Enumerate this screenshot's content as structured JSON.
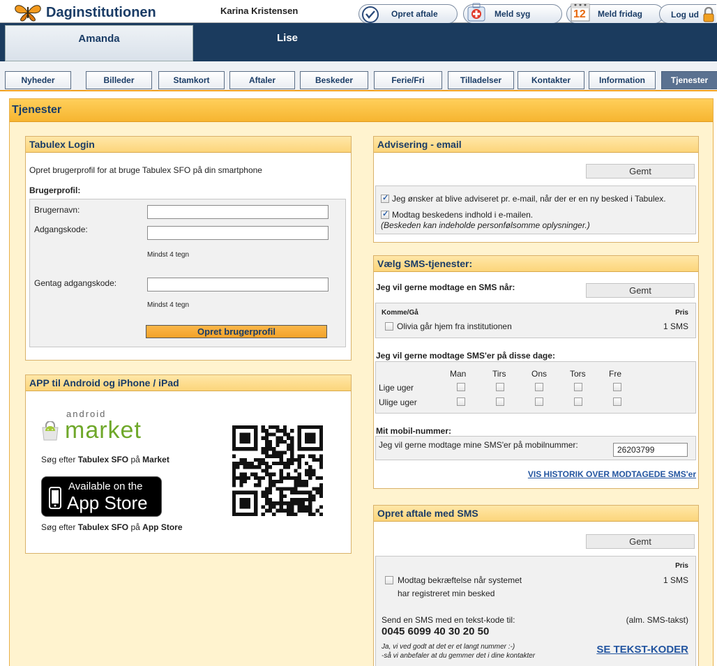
{
  "header": {
    "app_name": "Daginstitutionen",
    "user_name": "Karina Kristensen",
    "buttons": {
      "appointment": "Opret aftale",
      "sick": "Meld syg",
      "dayoff": "Meld fridag",
      "calendar_day": "12",
      "logout": "Log ud"
    }
  },
  "children": [
    {
      "name": "Amanda"
    },
    {
      "name": "Lise"
    }
  ],
  "nav": [
    {
      "label": "Nyheder"
    },
    {
      "label": "Billeder"
    },
    {
      "label": "Stamkort"
    },
    {
      "label": "Aftaler"
    },
    {
      "label": "Beskeder"
    },
    {
      "label": "Ferie/Fri"
    },
    {
      "label": "Tilladelser"
    },
    {
      "label": "Kontakter"
    },
    {
      "label": "Information"
    },
    {
      "label": "Tjenester"
    }
  ],
  "page": {
    "title": "Tjenester"
  },
  "login": {
    "title": "Tabulex Login",
    "intro": "Opret brugerprofil for at bruge Tabulex SFO på din smartphone",
    "profile_heading": "Brugerprofil:",
    "username_label": "Brugernavn:",
    "password_label": "Adgangskode:",
    "min_hint": "Mindst 4 tegn",
    "repeat_label": "Gentag adgangskode:",
    "submit": "Opret brugerprofil"
  },
  "app": {
    "title": "APP til Android og iPhone / iPad",
    "android_small": "android",
    "android_big": "market",
    "android_pre": "Søg efter ",
    "android_mid": "Tabulex SFO",
    "android_on": " på ",
    "android_post": "Market",
    "appstore_line1": "Available on the",
    "appstore_line2": "App Store",
    "ios_pre": "Søg efter ",
    "ios_mid": "Tabulex SFO",
    "ios_on": " på ",
    "ios_post": "App Store"
  },
  "email": {
    "title": "Advisering - email",
    "saved": "Gemt",
    "opt1": "Jeg ønsker at blive adviseret pr. e-mail, når der er en ny besked i Tabulex.",
    "opt2": "Modtag beskedens indhold i e-mailen.",
    "note": "(Beskeden kan indeholde personfølsomme oplysninger.)"
  },
  "sms": {
    "title": "Vælg SMS-tjenester:",
    "intro": "Jeg vil gerne modtage en SMS når:",
    "saved": "Gemt",
    "group": "Komme/Gå",
    "price_header": "Pris",
    "item": "Olivia går hjem fra institutionen",
    "item_price": "1 SMS",
    "days_heading": "Jeg vil gerne modtage SMS'er på disse dage:",
    "days": [
      "Man",
      "Tirs",
      "Ons",
      "Tors",
      "Fre"
    ],
    "rows": [
      "Lige uger",
      "Ulige uger"
    ],
    "mobile_heading": "Mit mobil-nummer:",
    "mobile_label": "Jeg vil gerne modtage mine SMS'er på mobilnummer:",
    "mobile_value": "26203799",
    "history_link": "VIS HISTORIK OVER MODTAGEDE SMS'er"
  },
  "smsappt": {
    "title": "Opret aftale med SMS",
    "saved": "Gemt",
    "price_header": "Pris",
    "confirm_line1": "Modtag bekræftelse når systemet",
    "confirm_line2": "har registreret min besked",
    "confirm_price": "1 SMS",
    "send_label": "Send en SMS med en tekst-kode til:",
    "rate": "(alm. SMS-takst)",
    "number": "0045 6099 40 30 20 50",
    "note1": "Ja, vi ved godt at det er et langt nummer :-)",
    "note2": "-så vi anbefaler at du gemmer det i dine kontakter",
    "codes_link": "SE TEKST-KODER"
  },
  "colors": {
    "brand": "#1a3c66",
    "accent": "#f6b531",
    "link": "#2355a0"
  }
}
